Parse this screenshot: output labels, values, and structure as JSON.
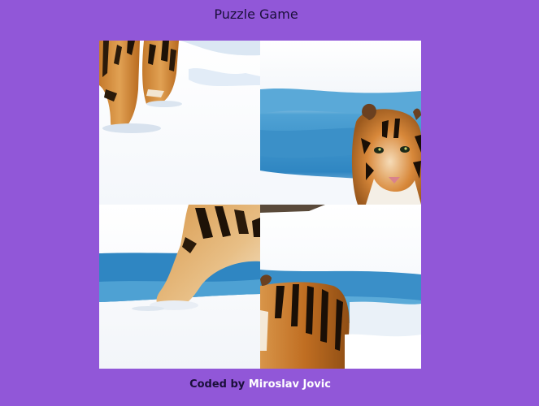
{
  "game": {
    "title": "Puzzle Game"
  },
  "board": {
    "tiles": [
      {
        "piece": "tiger-legs-top-left"
      },
      {
        "piece": "tiger-head"
      },
      {
        "piece": "tiger-front-leg"
      },
      {
        "piece": "tiger-back"
      }
    ]
  },
  "footer": {
    "prefix": "Coded by",
    "author": "Miroslav Jovic"
  },
  "colors": {
    "background": "#9157d8",
    "title": "#1a0f3a",
    "author_link": "#ffffff"
  }
}
